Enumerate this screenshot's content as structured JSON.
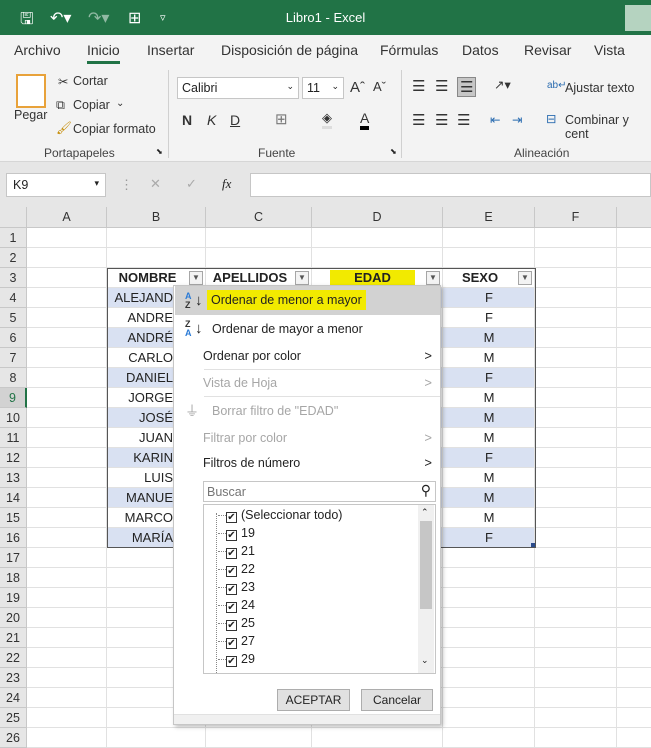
{
  "window": {
    "title": "Libro1  -  Excel"
  },
  "tabs": [
    "Archivo",
    "Inicio",
    "Insertar",
    "Disposición de página",
    "Fórmulas",
    "Datos",
    "Revisar",
    "Vista"
  ],
  "active_tab": "Inicio",
  "ribbon": {
    "clipboard": {
      "paste": "Pegar",
      "cut": "Cortar",
      "copy": "Copiar",
      "format_painter": "Copiar formato",
      "group": "Portapapeles"
    },
    "font": {
      "name": "Calibri",
      "size": "11",
      "bold": "N",
      "italic": "K",
      "underline": "D",
      "font_color_glyph": "A",
      "group": "Fuente"
    },
    "alignment": {
      "wrap": "Ajustar texto",
      "merge": "Combinar y cent",
      "group": "Alineación"
    }
  },
  "formula_bar": {
    "name_box": "K9",
    "fx": "fx",
    "value": ""
  },
  "columns": [
    "A",
    "B",
    "C",
    "D",
    "E",
    "F"
  ],
  "rows": [
    "1",
    "2",
    "3",
    "4",
    "5",
    "6",
    "7",
    "8",
    "9",
    "10",
    "11",
    "12",
    "13",
    "14",
    "15",
    "16",
    "17",
    "18",
    "19",
    "20",
    "21",
    "22",
    "23",
    "24",
    "25",
    "26"
  ],
  "selected_row": "9",
  "table": {
    "headers": [
      "NOMBRE",
      "APELLIDOS",
      "EDAD",
      "SEXO"
    ],
    "nombre": [
      "ALEJAND",
      "ANDRE",
      "ANDRÉ",
      "CARLO",
      "DANIEL",
      "JORGE",
      "JOSÉ",
      "JUAN",
      "KARIN",
      "LUIS",
      "MANUE",
      "MARCO",
      "MARÍA"
    ],
    "sexo": [
      "F",
      "F",
      "M",
      "M",
      "F",
      "M",
      "M",
      "M",
      "F",
      "M",
      "M",
      "M",
      "F"
    ]
  },
  "highlight_color": "#f2ea00",
  "filter_menu": {
    "sort_asc": "Ordenar de menor a mayor",
    "sort_desc": "Ordenar de mayor a menor",
    "sort_color": "Ordenar por color",
    "sheet_view": "Vista de Hoja",
    "clear_filter": "Borrar filtro de \"EDAD\"",
    "filter_color": "Filtrar por color",
    "number_filters": "Filtros de número",
    "search_placeholder": "Buscar",
    "items": [
      "(Seleccionar todo)",
      "19",
      "21",
      "22",
      "23",
      "24",
      "25",
      "27",
      "29"
    ],
    "ok": "ACEPTAR",
    "cancel": "Cancelar"
  }
}
